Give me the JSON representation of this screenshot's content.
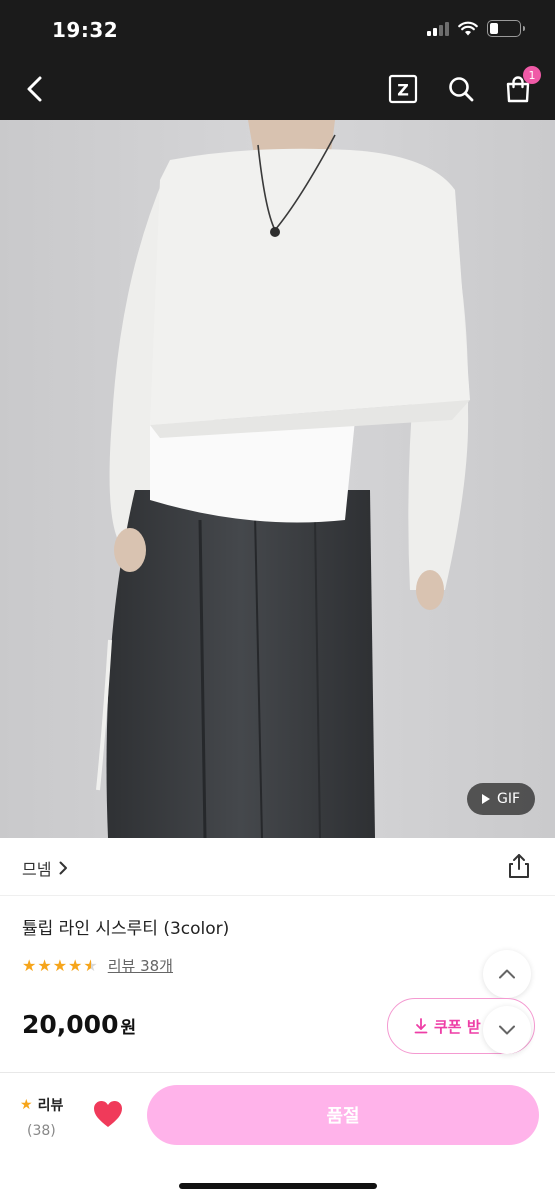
{
  "status_bar": {
    "time": "19:32"
  },
  "header": {
    "cart_count": "1",
    "zigzag_letter": "Z"
  },
  "hero": {
    "gif_label": "GIF"
  },
  "shop": {
    "name": "므넴"
  },
  "product": {
    "title": "튤립 라인 시스루티 (3color)",
    "rating_stars": 4.5,
    "review_link": "리뷰 38개",
    "price": "20,000",
    "currency": "원"
  },
  "coupon": {
    "label": "쿠폰 받"
  },
  "bottom_bar": {
    "review_label": "리뷰",
    "review_count": "(38)",
    "soldout_label": "품절"
  },
  "colors": {
    "accent": "#ee3ea6",
    "soldout_bg": "#ffb3ea",
    "star": "#f6a51b",
    "heart": "#f03a5a"
  }
}
